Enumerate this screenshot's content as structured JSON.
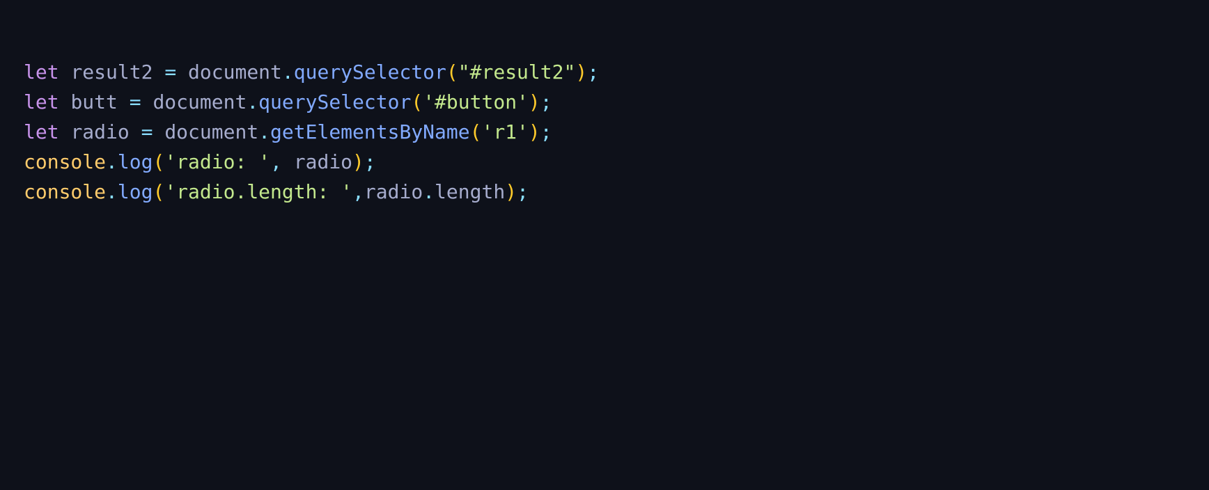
{
  "code_lines": [
    [
      {
        "t": "let",
        "c": "kw"
      },
      {
        "t": " ",
        "c": "id"
      },
      {
        "t": "result2",
        "c": "id"
      },
      {
        "t": " ",
        "c": "id"
      },
      {
        "t": "=",
        "c": "op"
      },
      {
        "t": " ",
        "c": "id"
      },
      {
        "t": "document",
        "c": "id"
      },
      {
        "t": ".",
        "c": "pun"
      },
      {
        "t": "querySelector",
        "c": "fn"
      },
      {
        "t": "(",
        "c": "par"
      },
      {
        "t": "\"#result2\"",
        "c": "str"
      },
      {
        "t": ")",
        "c": "par"
      },
      {
        "t": ";",
        "c": "pun"
      }
    ],
    [
      {
        "t": "let",
        "c": "kw"
      },
      {
        "t": " ",
        "c": "id"
      },
      {
        "t": "butt",
        "c": "id"
      },
      {
        "t": " ",
        "c": "id"
      },
      {
        "t": "=",
        "c": "op"
      },
      {
        "t": " ",
        "c": "id"
      },
      {
        "t": "document",
        "c": "id"
      },
      {
        "t": ".",
        "c": "pun"
      },
      {
        "t": "querySelector",
        "c": "fn"
      },
      {
        "t": "(",
        "c": "par"
      },
      {
        "t": "'#button'",
        "c": "str"
      },
      {
        "t": ")",
        "c": "par"
      },
      {
        "t": ";",
        "c": "pun"
      }
    ],
    [
      {
        "t": "let",
        "c": "kw"
      },
      {
        "t": " ",
        "c": "id"
      },
      {
        "t": "radio",
        "c": "id"
      },
      {
        "t": " ",
        "c": "id"
      },
      {
        "t": "=",
        "c": "op"
      },
      {
        "t": " ",
        "c": "id"
      },
      {
        "t": "document",
        "c": "id"
      },
      {
        "t": ".",
        "c": "pun"
      },
      {
        "t": "getElementsByName",
        "c": "fn"
      },
      {
        "t": "(",
        "c": "par"
      },
      {
        "t": "'r1'",
        "c": "str"
      },
      {
        "t": ")",
        "c": "par"
      },
      {
        "t": ";",
        "c": "pun"
      }
    ],
    [
      {
        "t": "console",
        "c": "obj"
      },
      {
        "t": ".",
        "c": "pun"
      },
      {
        "t": "log",
        "c": "fn"
      },
      {
        "t": "(",
        "c": "par"
      },
      {
        "t": "'radio: '",
        "c": "str"
      },
      {
        "t": ",",
        "c": "pun"
      },
      {
        "t": " ",
        "c": "id"
      },
      {
        "t": "radio",
        "c": "id"
      },
      {
        "t": ")",
        "c": "par"
      },
      {
        "t": ";",
        "c": "pun"
      }
    ],
    [
      {
        "t": "console",
        "c": "obj"
      },
      {
        "t": ".",
        "c": "pun"
      },
      {
        "t": "log",
        "c": "fn"
      },
      {
        "t": "(",
        "c": "par"
      },
      {
        "t": "'radio.length: '",
        "c": "str"
      },
      {
        "t": ",",
        "c": "pun"
      },
      {
        "t": "radio",
        "c": "id"
      },
      {
        "t": ".",
        "c": "pun"
      },
      {
        "t": "length",
        "c": "id"
      },
      {
        "t": ")",
        "c": "par"
      },
      {
        "t": ";",
        "c": "pun"
      }
    ]
  ],
  "colors": {
    "background": "#0e111a",
    "keyword": "#c792ea",
    "identifier": "#a6accd",
    "operator": "#89ddff",
    "function": "#82aaff",
    "paren": "#ffcb2b",
    "string": "#c3e88d",
    "object": "#ffcb6b"
  }
}
